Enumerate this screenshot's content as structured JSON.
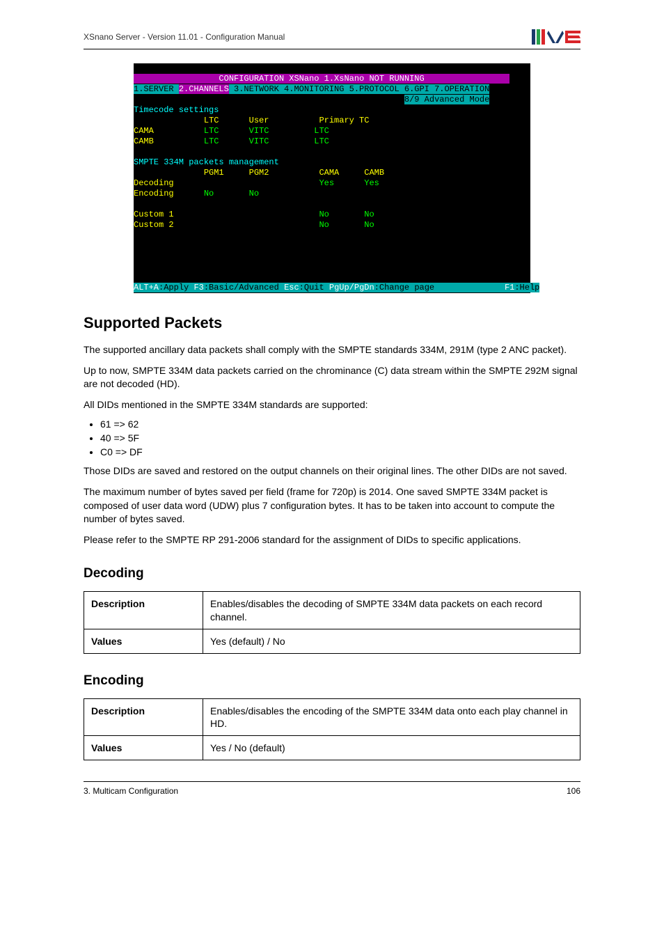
{
  "header": {
    "title": "XSnano Server - Version 11.01 - Configuration Manual"
  },
  "terminal": {
    "title": " CONFIGURATION XSNano 1.XsNano NOT RUNNING ",
    "tabs_left": "1.SERVER ",
    "tab_active": "2.CHANNELS",
    "tabs_right": " 3.NETWORK 4.MONITORING 5.PROTOCOL 6.GPI 7.OPERATION",
    "mode": "8/9 Advanced Mode",
    "tc_heading": "Timecode settings",
    "tc_cols": "              LTC      User          Primary TC",
    "tc_row1a": "CAMA          ",
    "tc_row1b": "LTC      VITC         LTC",
    "tc_row2a": "CAMB          ",
    "tc_row2b": "LTC      VITC         LTC",
    "smpte_heading": "SMPTE 334M packets management",
    "smpte_cols": "              PGM1     PGM2          CAMA     CAMB",
    "smpte_dec_a": "Decoding                             ",
    "smpte_dec_b": "Yes      Yes",
    "smpte_enc_a": "Encoding      ",
    "smpte_enc_b": "No       No",
    "smpte_c1_a": "Custom 1                             ",
    "smpte_c1_b": "No       No",
    "smpte_c2_a": "Custom 2                             ",
    "smpte_c2_b": "No       No",
    "status_alt": "ALT+A",
    "status_apply": ":Apply ",
    "status_f3": "F3",
    "status_basic": ":Basic/Advanced ",
    "status_esc": "Esc",
    "status_quit": ":Quit ",
    "status_pg": "PgUp/PgDn",
    "status_change": ":Change page",
    "status_pad": "              ",
    "status_f1": "F1",
    "status_help": ":Help"
  },
  "supported": {
    "heading": "Supported Packets",
    "p1": "The supported ancillary data packets shall comply with the SMPTE standards 334M, 291M (type 2 ANC packet).",
    "p2": "Up to now, SMPTE 334M data packets carried on the chrominance (C) data stream within the SMPTE 292M signal are not decoded (HD).",
    "p3": "All DIDs mentioned in the SMPTE 334M standards are supported:",
    "li1": "61 => 62",
    "li2": "40 => 5F",
    "li3": "C0 => DF",
    "p4": "Those DIDs are saved and restored on the output channels on their original lines. The other DIDs are not saved.",
    "p5": "The maximum number of bytes saved per field (frame for 720p) is 2014. One saved SMPTE 334M packet is composed of user data word (UDW) plus 7 configuration bytes. It has to be taken into account to compute the number of bytes saved.",
    "p6": "Please refer to the SMPTE RP 291-2006 standard for the assignment of DIDs to specific applications."
  },
  "decoding": {
    "heading": "Decoding",
    "desc_label": "Description",
    "desc_value": "Enables/disables the decoding of SMPTE 334M data packets on each record channel.",
    "values_label": "Values",
    "values_value": "Yes (default) / No"
  },
  "encoding": {
    "heading": "Encoding",
    "desc_label": "Description",
    "desc_value": "Enables/disables the encoding of the SMPTE 334M data onto each play channel in HD.",
    "values_label": "Values",
    "values_value": "Yes / No (default)"
  },
  "footer": {
    "left": "3. Multicam Configuration",
    "right": "106"
  }
}
